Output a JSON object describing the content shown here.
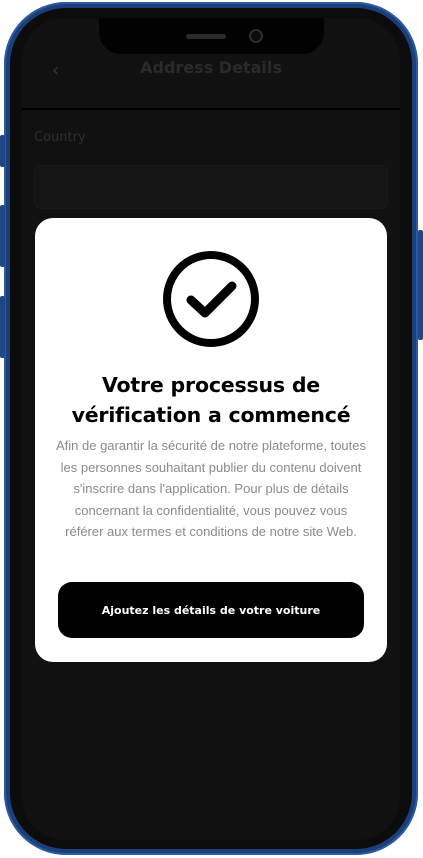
{
  "header": {
    "back_icon": "chevron-left-icon",
    "title": "Address Details"
  },
  "form": {
    "country_label": "Country"
  },
  "modal": {
    "icon": "check-circle-icon",
    "title_line1": "Votre processus de",
    "title_line2": "vérification a commencé",
    "body": "Afin de garantir la sécurité de notre plateforme, toutes les personnes souhaitant publier du contenu doivent s'inscrire dans l'application. Pour plus de détails concernant la confidentialité, vous pouvez vous référer aux termes et conditions de notre site Web.",
    "button_label": "Ajoutez les détails de votre voiture"
  },
  "colors": {
    "frame": "#1b3f78",
    "overlay": "#111111",
    "modal_bg": "#ffffff",
    "button_bg": "#000000",
    "body_text": "#8a8a8a"
  }
}
